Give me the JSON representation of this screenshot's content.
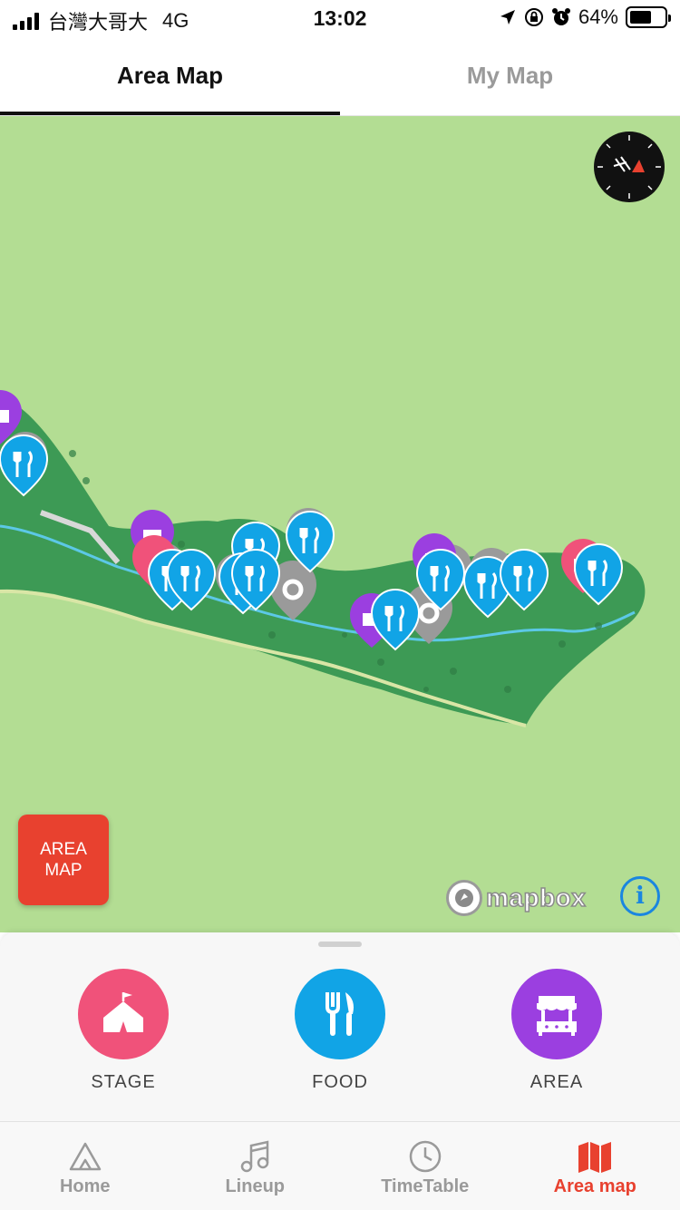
{
  "status_bar": {
    "carrier": "台灣大哥大",
    "network": "4G",
    "time": "13:02",
    "battery": "64%",
    "battery_level": 0.64
  },
  "tabs": [
    {
      "label": "Area Map",
      "active": true
    },
    {
      "label": "My Map",
      "active": false
    }
  ],
  "map": {
    "area_map_button": "AREA MAP",
    "attribution": "mapbox",
    "info_icon": "info-icon",
    "compass_icon": "compass-icon"
  },
  "categories": [
    {
      "label": "STAGE",
      "color": "#f0527a",
      "icon": "tent-icon"
    },
    {
      "label": "FOOD",
      "color": "#11a4e6",
      "icon": "fork-knife-icon"
    },
    {
      "label": "AREA",
      "color": "#9b3fe0",
      "icon": "market-stall-icon"
    }
  ],
  "tabbar": [
    {
      "label": "Home",
      "icon": "home-tent-icon",
      "active": false
    },
    {
      "label": "Lineup",
      "icon": "music-note-icon",
      "active": false
    },
    {
      "label": "TimeTable",
      "icon": "clock-icon",
      "active": false
    },
    {
      "label": "Area map",
      "icon": "map-icon",
      "active": true
    }
  ],
  "colors": {
    "accent": "#e8412f",
    "map_background": "#b3dd93",
    "food_pin": "#11a4e6",
    "area_pin": "#9b3fe0",
    "stage_pin": "#f0527a",
    "other_pin": "#9a9a9a"
  }
}
